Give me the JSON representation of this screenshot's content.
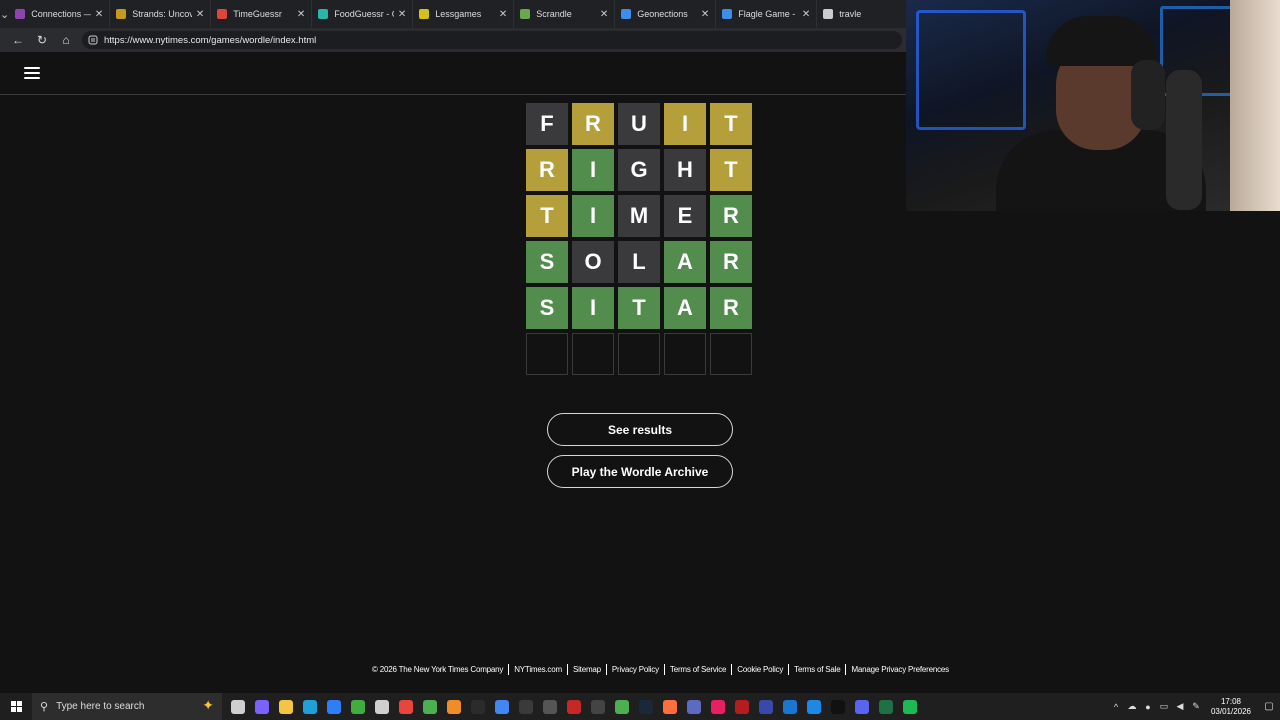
{
  "browser": {
    "tabs": [
      {
        "title": "Connections — Th",
        "color": "#8e44ad"
      },
      {
        "title": "Strands: Uncover",
        "color": "#c79a1f"
      },
      {
        "title": "TimeGuessr",
        "color": "#e0453a"
      },
      {
        "title": "FoodGuessr - Gue",
        "color": "#2bb4a8"
      },
      {
        "title": "Lessgames",
        "color": "#d4c21a"
      },
      {
        "title": "Scrandle",
        "color": "#6aa84f"
      },
      {
        "title": "Geonections",
        "color": "#3d8eea"
      },
      {
        "title": "Flagle Game - Da",
        "color": "#3d8eea"
      },
      {
        "title": "travle",
        "color": "#cccccc"
      }
    ],
    "url": "https://www.nytimes.com/games/wordle/index.html"
  },
  "board": {
    "rows": [
      {
        "letters": [
          "F",
          "R",
          "U",
          "I",
          "T"
        ],
        "states": [
          "absent",
          "present",
          "absent",
          "present",
          "present"
        ]
      },
      {
        "letters": [
          "R",
          "I",
          "G",
          "H",
          "T"
        ],
        "states": [
          "present",
          "correct",
          "absent",
          "absent",
          "present"
        ]
      },
      {
        "letters": [
          "T",
          "I",
          "M",
          "E",
          "R"
        ],
        "states": [
          "present",
          "correct",
          "absent",
          "absent",
          "correct"
        ]
      },
      {
        "letters": [
          "S",
          "O",
          "L",
          "A",
          "R"
        ],
        "states": [
          "correct",
          "absent",
          "absent",
          "correct",
          "correct"
        ]
      },
      {
        "letters": [
          "S",
          "I",
          "T",
          "A",
          "R"
        ],
        "states": [
          "correct",
          "correct",
          "correct",
          "correct",
          "correct"
        ]
      },
      {
        "letters": [
          "",
          "",
          "",
          "",
          ""
        ],
        "states": [
          "empty",
          "empty",
          "empty",
          "empty",
          "empty"
        ]
      }
    ],
    "colors": {
      "correct": "#538d4e",
      "present": "#b59f3b",
      "absent": "#3a3a3c"
    }
  },
  "buttons": {
    "see_results": "See results",
    "archive": "Play the Wordle Archive"
  },
  "footer": {
    "links": [
      "© 2026 The New York Times Company",
      "NYTimes.com",
      "Sitemap",
      "Privacy Policy",
      "Terms of Service",
      "Cookie Policy",
      "Terms of Sale",
      "Manage Privacy Preferences"
    ]
  },
  "taskbar": {
    "search_placeholder": "Type here to search",
    "time": "17:08",
    "date": "03/01/2026",
    "app_icons": [
      {
        "name": "task-view-icon",
        "color": "#cfcfcf"
      },
      {
        "name": "copilot-icon",
        "color": "#7b61ff"
      },
      {
        "name": "file-explorer-icon",
        "color": "#f4c542"
      },
      {
        "name": "edge-icon",
        "color": "#1ea0d8"
      },
      {
        "name": "mail-icon",
        "color": "#2d7ff9"
      },
      {
        "name": "xbox-icon",
        "color": "#3fae3f"
      },
      {
        "name": "store-icon",
        "color": "#cfcfcf"
      },
      {
        "name": "chrome-icon",
        "color": "#e8453c"
      },
      {
        "name": "chrome-alt-icon",
        "color": "#4caf50"
      },
      {
        "name": "app-orange-icon",
        "color": "#f28c28"
      },
      {
        "name": "app-dark-icon",
        "color": "#2b2b2b"
      },
      {
        "name": "chrome-beta-icon",
        "color": "#4285f4"
      },
      {
        "name": "obs-icon",
        "color": "#3a3a3a"
      },
      {
        "name": "app-grid-icon",
        "color": "#555555"
      },
      {
        "name": "app-red-icon",
        "color": "#c62828"
      },
      {
        "name": "app-4k-icon",
        "color": "#444444"
      },
      {
        "name": "minecraft-icon",
        "color": "#4caf50"
      },
      {
        "name": "steam-icon",
        "color": "#1b2838"
      },
      {
        "name": "app-gradient-icon",
        "color": "#ff6f3c"
      },
      {
        "name": "app-v-icon",
        "color": "#5c6bc0"
      },
      {
        "name": "maps-pin-icon",
        "color": "#e91e63"
      },
      {
        "name": "app-ring-icon",
        "color": "#b71c1c"
      },
      {
        "name": "app-circle-icon",
        "color": "#3949ab"
      },
      {
        "name": "app-square-icon",
        "color": "#1976d2"
      },
      {
        "name": "app-triangle-icon",
        "color": "#1e88e5"
      },
      {
        "name": "tiktok-icon",
        "color": "#111111"
      },
      {
        "name": "discord-icon",
        "color": "#5865f2"
      },
      {
        "name": "excel-icon",
        "color": "#1e7145"
      },
      {
        "name": "spotify-icon",
        "color": "#1db954"
      }
    ]
  }
}
